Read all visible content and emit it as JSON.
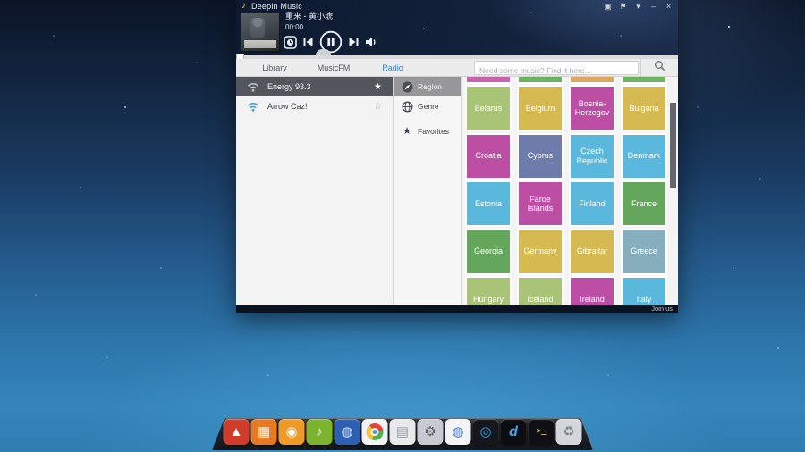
{
  "window": {
    "title": "Deepin Music",
    "controls": {
      "theme": "▣",
      "lyric": "⚑",
      "menu": "▾",
      "minimize": "–",
      "close": "×"
    },
    "player": {
      "song": "重来 - 黄小琥",
      "time": "00:00"
    },
    "tabs": [
      {
        "label": "Library",
        "active": false
      },
      {
        "label": "MusicFM",
        "active": false
      },
      {
        "label": "Radio",
        "active": true
      }
    ],
    "search": {
      "placeholder": "Need some music? Find it here..."
    },
    "stations": [
      {
        "name": "Energy 93.3",
        "favorited": true,
        "active": true,
        "star": "★"
      },
      {
        "name": "Arrow Caz!",
        "favorited": false,
        "active": false,
        "star": "☆"
      }
    ],
    "nav": [
      {
        "label": "Region",
        "active": true
      },
      {
        "label": "Genre",
        "active": false
      },
      {
        "label": "Favorites",
        "active": false,
        "star": "★"
      }
    ],
    "grid": {
      "partial_top_colors": [
        "#c763af",
        "#6db261",
        "#dca75f",
        "#6db261"
      ],
      "tiles": [
        {
          "label": "Belarus",
          "color": "#a9c377"
        },
        {
          "label": "Belgium",
          "color": "#d5ba52"
        },
        {
          "label": "Bosnia-Herzegov",
          "color": "#bc4fa4"
        },
        {
          "label": "Bulgaria",
          "color": "#d5ba52"
        },
        {
          "label": "Croatia",
          "color": "#bc4fa4"
        },
        {
          "label": "Cyprus",
          "color": "#6d7cab"
        },
        {
          "label": "Czech Republic",
          "color": "#5bb8dd"
        },
        {
          "label": "Denmark",
          "color": "#5bb8dd"
        },
        {
          "label": "Estonia",
          "color": "#5bb8dd"
        },
        {
          "label": "Faroe Islands",
          "color": "#bc4fa4"
        },
        {
          "label": "Finland",
          "color": "#5bb8dd"
        },
        {
          "label": "France",
          "color": "#64a75c"
        },
        {
          "label": "Georgia",
          "color": "#64a75c"
        },
        {
          "label": "Germany",
          "color": "#d5ba52"
        },
        {
          "label": "Gibraltar",
          "color": "#d5ba52"
        },
        {
          "label": "Greece",
          "color": "#86aebd"
        },
        {
          "label": "Hungary",
          "color": "#a9c377"
        },
        {
          "label": "Iceland",
          "color": "#a9c377"
        },
        {
          "label": "Ireland",
          "color": "#bc4fa4"
        },
        {
          "label": "Italy",
          "color": "#5bb8dd"
        }
      ]
    },
    "footer": {
      "join": "Join us"
    }
  },
  "dock": {
    "icons": [
      {
        "name": "launcher-icon",
        "bg": "#d13c2a",
        "glyph": "▲",
        "fg": "#ffffff"
      },
      {
        "name": "file-manager-icon",
        "bg": "#e8791f",
        "glyph": "▦",
        "fg": "#ffffff"
      },
      {
        "name": "app-store-icon",
        "bg": "#f09a26",
        "glyph": "◉",
        "fg": "#ffffff"
      },
      {
        "name": "music-icon",
        "bg": "#7cb42c",
        "glyph": "♪",
        "fg": "#ffffff"
      },
      {
        "name": "media-player-icon",
        "bg": "#2d5fb3",
        "glyph": "◍",
        "fg": "#dce9f8"
      },
      {
        "name": "chrome-icon",
        "bg": "#f2f3f5"
      },
      {
        "name": "documents-icon",
        "bg": "#e8e9eb",
        "glyph": "▤",
        "fg": "#9aa0a8"
      },
      {
        "name": "settings-icon",
        "bg": "#c7cad0",
        "glyph": "⚙",
        "fg": "#585d64"
      },
      {
        "name": "browser-icon",
        "bg": "#f3f4f6",
        "glyph": "◍",
        "fg": "#3f7fd2"
      },
      {
        "name": "screenshot-icon",
        "bg": "#14171c",
        "glyph": "◎",
        "fg": "#3aa8ea"
      },
      {
        "name": "dmusic-icon",
        "bg": "#0b0d11",
        "glyph": "d",
        "fg": "#4aa4ea"
      },
      {
        "name": "terminal-icon",
        "bg": "#0e1013",
        "glyph": ">_",
        "fg": "#e6c24c"
      },
      {
        "name": "trash-icon",
        "bg": "#d3d6da",
        "glyph": "♻",
        "fg": "#7c8188"
      }
    ]
  }
}
